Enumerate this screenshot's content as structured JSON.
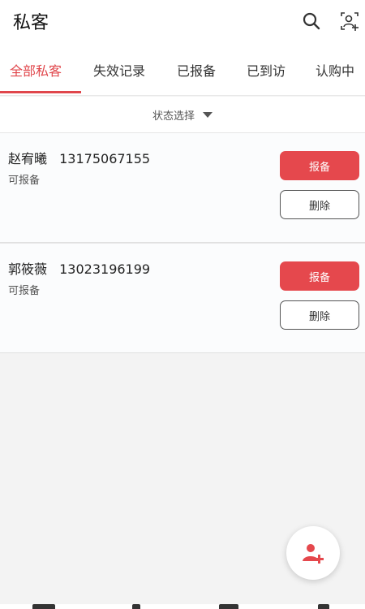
{
  "header": {
    "title": "私客",
    "search_icon": "search-icon",
    "contact_icon": "contact-add-icon"
  },
  "tabs": [
    {
      "label": "全部私客",
      "active": true
    },
    {
      "label": "失效记录",
      "active": false
    },
    {
      "label": "已报备",
      "active": false
    },
    {
      "label": "已到访",
      "active": false
    },
    {
      "label": "认购中",
      "active": false
    }
  ],
  "filter": {
    "label": "状态选择",
    "icon": "caret-down-icon"
  },
  "customers": [
    {
      "name": "赵宥曦",
      "phone": "13175067155",
      "status": "可报备",
      "report_label": "报备",
      "delete_label": "删除"
    },
    {
      "name": "郭筱薇",
      "phone": "13023196199",
      "status": "可报备",
      "report_label": "报备",
      "delete_label": "删除"
    }
  ],
  "fab": {
    "icon": "add-user-icon"
  },
  "colors": {
    "accent": "#e5484d",
    "tab_active": "#e0464b",
    "background": "#f3f3f3"
  }
}
